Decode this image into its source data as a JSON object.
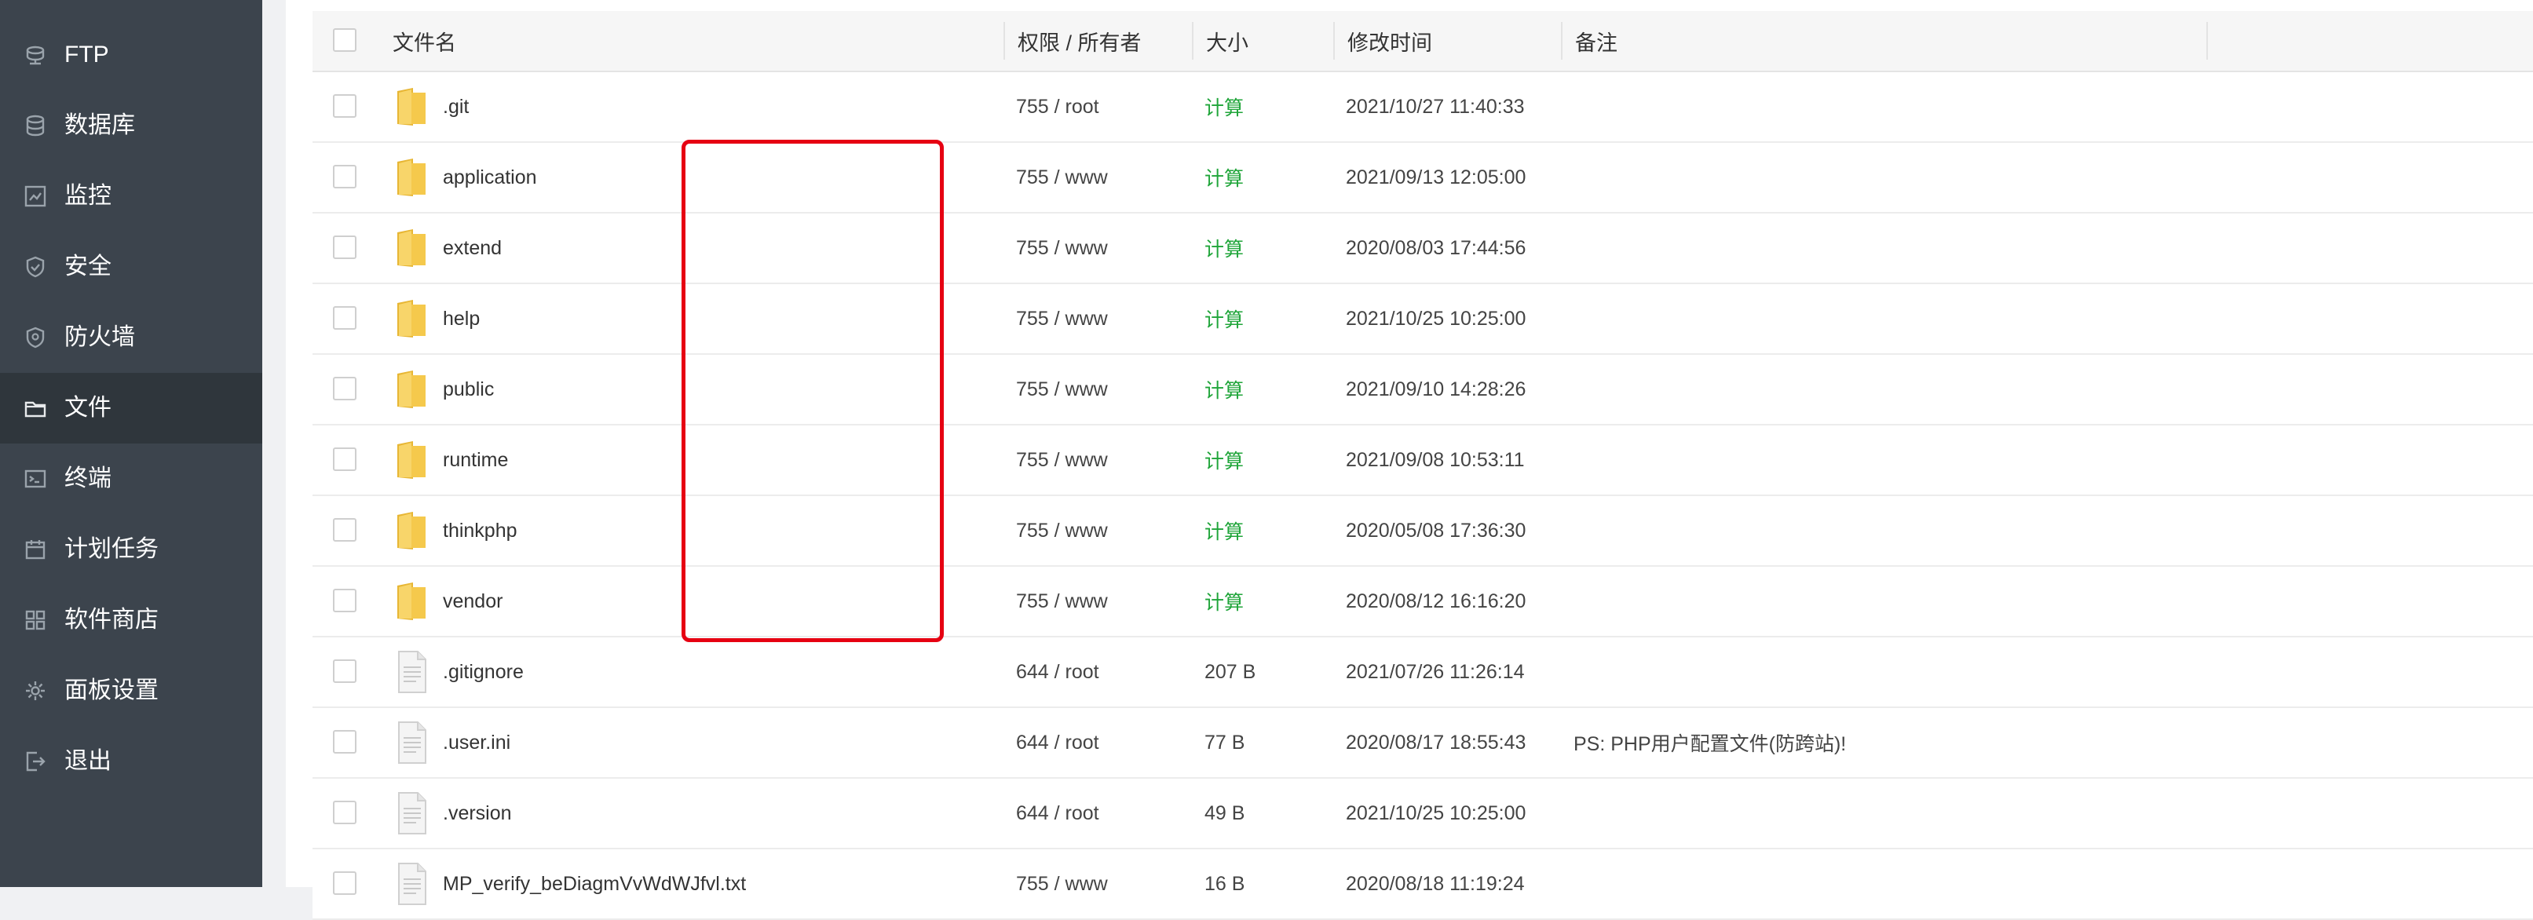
{
  "sidebar": {
    "items": [
      {
        "label": "FTP",
        "icon": "ftp-icon",
        "active": false
      },
      {
        "label": "数据库",
        "icon": "database-icon",
        "active": false
      },
      {
        "label": "监控",
        "icon": "monitor-icon",
        "active": false
      },
      {
        "label": "安全",
        "icon": "shield-icon",
        "active": false
      },
      {
        "label": "防火墙",
        "icon": "firewall-icon",
        "active": false
      },
      {
        "label": "文件",
        "icon": "folder-icon",
        "active": true
      },
      {
        "label": "终端",
        "icon": "terminal-icon",
        "active": false
      },
      {
        "label": "计划任务",
        "icon": "calendar-icon",
        "active": false
      },
      {
        "label": "软件商店",
        "icon": "apps-icon",
        "active": false
      },
      {
        "label": "面板设置",
        "icon": "gear-icon",
        "active": false
      },
      {
        "label": "退出",
        "icon": "logout-icon",
        "active": false
      }
    ]
  },
  "table": {
    "headers": {
      "name": "文件名",
      "permission": "权限 / 所有者",
      "size": "大小",
      "mtime": "修改时间",
      "remark": "备注"
    },
    "rows": [
      {
        "type": "folder",
        "name": ".git",
        "perm": "755 / root",
        "size": "计算",
        "mtime": "2021/10/27 11:40:33",
        "remark": ""
      },
      {
        "type": "folder",
        "name": "application",
        "perm": "755 / www",
        "size": "计算",
        "mtime": "2021/09/13 12:05:00",
        "remark": ""
      },
      {
        "type": "folder",
        "name": "extend",
        "perm": "755 / www",
        "size": "计算",
        "mtime": "2020/08/03 17:44:56",
        "remark": ""
      },
      {
        "type": "folder",
        "name": "help",
        "perm": "755 / www",
        "size": "计算",
        "mtime": "2021/10/25 10:25:00",
        "remark": ""
      },
      {
        "type": "folder",
        "name": "public",
        "perm": "755 / www",
        "size": "计算",
        "mtime": "2021/09/10 14:28:26",
        "remark": ""
      },
      {
        "type": "folder",
        "name": "runtime",
        "perm": "755 / www",
        "size": "计算",
        "mtime": "2021/09/08 10:53:11",
        "remark": ""
      },
      {
        "type": "folder",
        "name": "thinkphp",
        "perm": "755 / www",
        "size": "计算",
        "mtime": "2020/05/08 17:36:30",
        "remark": ""
      },
      {
        "type": "folder",
        "name": "vendor",
        "perm": "755 / www",
        "size": "计算",
        "mtime": "2020/08/12 16:16:20",
        "remark": ""
      },
      {
        "type": "file",
        "name": ".gitignore",
        "perm": "644 / root",
        "size": "207 B",
        "mtime": "2021/07/26 11:26:14",
        "remark": ""
      },
      {
        "type": "file",
        "name": ".user.ini",
        "perm": "644 / root",
        "size": "77 B",
        "mtime": "2020/08/17 18:55:43",
        "remark": "PS: PHP用户配置文件(防跨站)!"
      },
      {
        "type": "file",
        "name": ".version",
        "perm": "644 / root",
        "size": "49 B",
        "mtime": "2021/10/25 10:25:00",
        "remark": ""
      },
      {
        "type": "file",
        "name": "MP_verify_beDiagmVvWdWJfvl.txt",
        "perm": "755 / www",
        "size": "16 B",
        "mtime": "2020/08/18 11:19:24",
        "remark": ""
      }
    ]
  },
  "colors": {
    "sidebar_bg": "#3c444d",
    "sidebar_active_bg": "#2f363c",
    "calc_link": "#20a53a",
    "highlight_border": "#e60012",
    "folder_yellow": "#f5c94c"
  }
}
